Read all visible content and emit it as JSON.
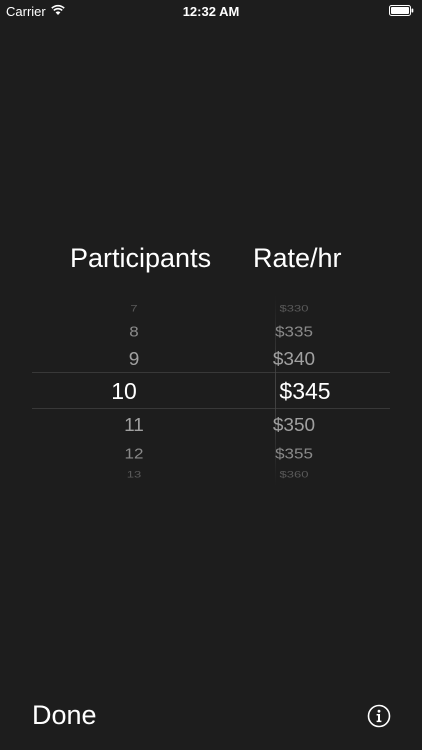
{
  "status_bar": {
    "carrier": "Carrier",
    "time": "12:32 AM"
  },
  "headers": {
    "participants": "Participants",
    "rate": "Rate/hr"
  },
  "picker": {
    "participants": {
      "options": [
        "7",
        "8",
        "9",
        "10",
        "11",
        "12",
        "13"
      ],
      "selected": "10"
    },
    "rate": {
      "options": [
        "$330",
        "$335",
        "$340",
        "$345",
        "$350",
        "$355",
        "$360"
      ],
      "selected": "$345"
    }
  },
  "toolbar": {
    "done_label": "Done",
    "info_icon": "info-icon"
  },
  "colors": {
    "background": "#1d1d1d",
    "text_primary": "#ffffff",
    "text_dim": "#8a8a8a"
  }
}
